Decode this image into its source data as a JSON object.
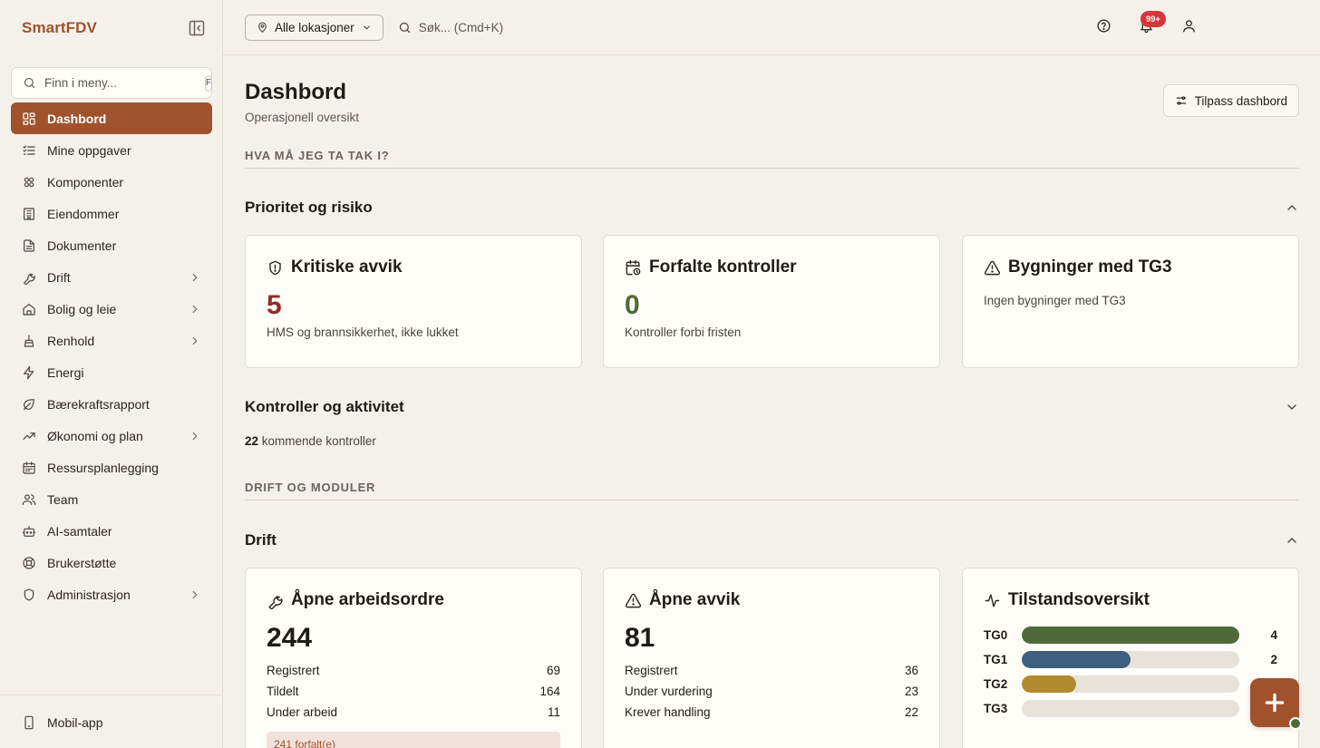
{
  "brand": "SmartFDV",
  "menu_search": {
    "placeholder": "Finn i meny...",
    "shortcut": "F"
  },
  "nav": [
    {
      "label": "Dashbord",
      "icon": "dashboard-icon",
      "active": true,
      "has_children": false
    },
    {
      "label": "Mine oppgaver",
      "icon": "tasks-icon",
      "active": false,
      "has_children": false
    },
    {
      "label": "Komponenter",
      "icon": "components-icon",
      "active": false,
      "has_children": false
    },
    {
      "label": "Eiendommer",
      "icon": "building-icon",
      "active": false,
      "has_children": false
    },
    {
      "label": "Dokumenter",
      "icon": "document-icon",
      "active": false,
      "has_children": false
    },
    {
      "label": "Drift",
      "icon": "wrench-icon",
      "active": false,
      "has_children": true
    },
    {
      "label": "Bolig og leie",
      "icon": "home-icon",
      "active": false,
      "has_children": true
    },
    {
      "label": "Renhold",
      "icon": "cleaning-icon",
      "active": false,
      "has_children": true
    },
    {
      "label": "Energi",
      "icon": "lightning-icon",
      "active": false,
      "has_children": false
    },
    {
      "label": "Bærekraftsrapport",
      "icon": "leaf-icon",
      "active": false,
      "has_children": false
    },
    {
      "label": "Økonomi og plan",
      "icon": "trending-up-icon",
      "active": false,
      "has_children": true
    },
    {
      "label": "Ressursplanlegging",
      "icon": "calendar-icon",
      "active": false,
      "has_children": false
    },
    {
      "label": "Team",
      "icon": "team-icon",
      "active": false,
      "has_children": false
    },
    {
      "label": "AI-samtaler",
      "icon": "bot-icon",
      "active": false,
      "has_children": false
    },
    {
      "label": "Brukerstøtte",
      "icon": "lifebuoy-icon",
      "active": false,
      "has_children": false
    },
    {
      "label": "Administrasjon",
      "icon": "shield-icon",
      "active": false,
      "has_children": true
    }
  ],
  "sidebar_footer": {
    "label": "Mobil-app"
  },
  "topbar": {
    "location_label": "Alle lokasjoner",
    "search_placeholder": "Søk... (Cmd+K)",
    "notification_badge": "99+"
  },
  "page": {
    "title": "Dashbord",
    "subtitle": "Operasjonell oversikt",
    "customize_label": "Tilpass dashbord"
  },
  "sections": {
    "action_label": "HVA MÅ JEG TA TAK I?",
    "modules_label": "DRIFT OG MODULER"
  },
  "priority_group": {
    "title": "Prioritet og risiko",
    "cards": {
      "critical": {
        "title": "Kritiske avvik",
        "value": "5",
        "desc": "HMS og brannsikkerhet, ikke lukket"
      },
      "overdue": {
        "title": "Forfalte kontroller",
        "value": "0",
        "desc": "Kontroller forbi fristen"
      },
      "tg3": {
        "title": "Bygninger med TG3",
        "desc": "Ingen bygninger med TG3"
      }
    }
  },
  "controls_group": {
    "title": "Kontroller og aktivitet",
    "upcoming_count": "22",
    "upcoming_text": "kommende kontroller"
  },
  "drift_group": {
    "title": "Drift",
    "work_orders": {
      "title": "Åpne arbeidsordre",
      "value": "244",
      "rows": [
        {
          "label": "Registrert",
          "value": "69"
        },
        {
          "label": "Tildelt",
          "value": "164"
        },
        {
          "label": "Under arbeid",
          "value": "11"
        }
      ],
      "overdue_text": "241 forfalt(e)"
    },
    "deviations": {
      "title": "Åpne avvik",
      "value": "81",
      "rows": [
        {
          "label": "Registrert",
          "value": "36"
        },
        {
          "label": "Under vurdering",
          "value": "23"
        },
        {
          "label": "Krever handling",
          "value": "22"
        }
      ]
    },
    "condition": {
      "title": "Tilstandsoversikt",
      "rows": [
        {
          "label": "TG0",
          "value": "4",
          "fraction": 1.0,
          "color": "#4d6b38"
        },
        {
          "label": "TG1",
          "value": "2",
          "fraction": 0.5,
          "color": "#3d5f80"
        },
        {
          "label": "TG2",
          "value": "1",
          "fraction": 0.25,
          "color": "#b08a2e"
        },
        {
          "label": "TG3",
          "value": "0",
          "fraction": 0,
          "color": "#9e3b2e"
        }
      ]
    }
  },
  "colors": {
    "accent": "#a0522d",
    "critical_value": "#8e2f2a",
    "ok_value": "#4d6b38",
    "badge": "#d9343a"
  }
}
